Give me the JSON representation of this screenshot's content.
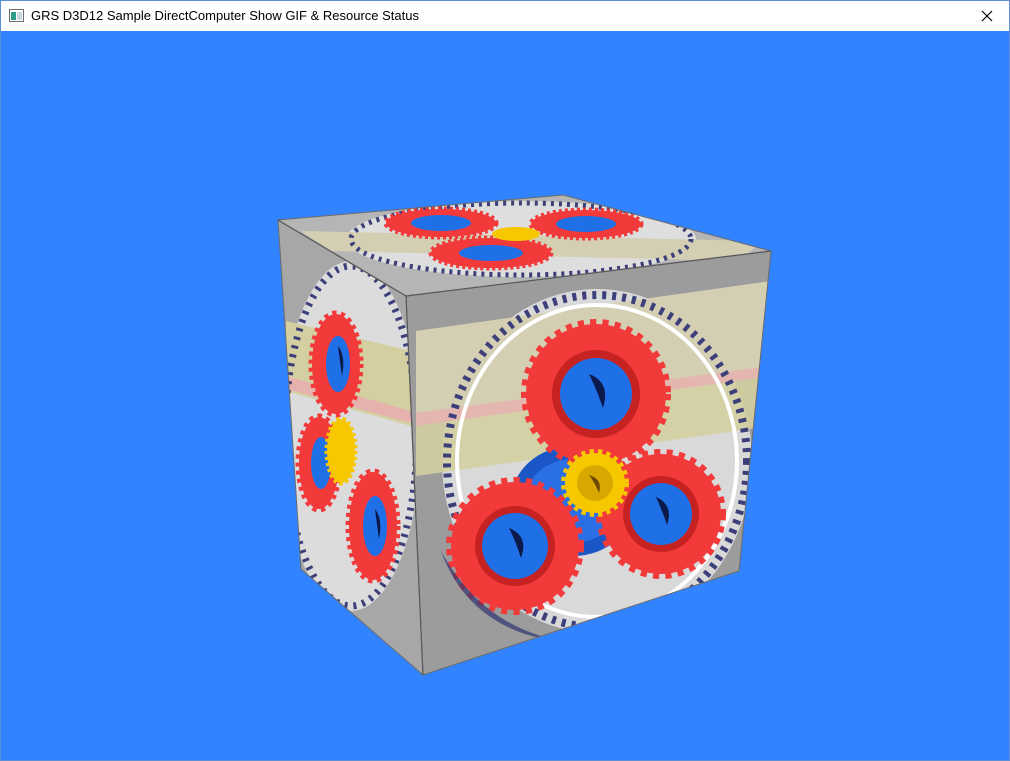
{
  "window": {
    "title": "GRS D3D12 Sample DirectComputer Show GIF & Resource Status",
    "app_icon": "window-app-icon",
    "close_icon": "close-icon"
  },
  "viewport": {
    "background_color": "#3183ff",
    "content": "rotating-textured-cube"
  },
  "colors": {
    "gear_red": "#f23a3a",
    "gear_blue": "#1f6fe6",
    "gear_yellow": "#f7c800",
    "cube_gray": "#c8c8c8"
  }
}
